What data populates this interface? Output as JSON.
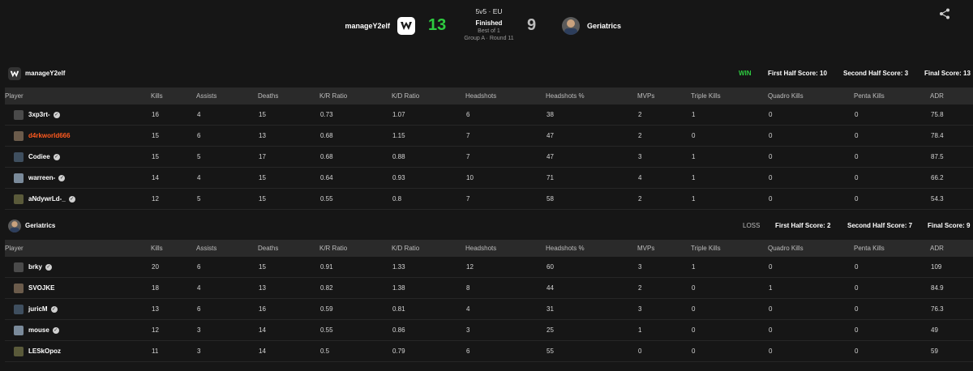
{
  "header": {
    "team_a": {
      "name": "manageY2elf",
      "score": "13"
    },
    "team_b": {
      "name": "Geriatrics",
      "score": "9"
    },
    "match": {
      "format": "5v5 · EU",
      "status": "Finished",
      "best_of": "Best of 1",
      "group": "Group A · Round 11"
    }
  },
  "columns": [
    "Player",
    "Kills",
    "Assists",
    "Deaths",
    "K/R Ratio",
    "K/D Ratio",
    "Headshots",
    "Headshots %",
    "MVPs",
    "Triple Kills",
    "Quadro Kills",
    "Penta Kills",
    "ADR"
  ],
  "team_a": {
    "name": "manageY2elf",
    "result": "WIN",
    "first_half": "First Half Score: 10",
    "second_half": "Second Half Score: 3",
    "final": "Final Score: 13",
    "players": [
      {
        "name": "3xp3rt-",
        "verified": true,
        "stats": [
          "16",
          "4",
          "15",
          "0.73",
          "1.07",
          "6",
          "38",
          "2",
          "1",
          "0",
          "0",
          "75.8"
        ]
      },
      {
        "name": "d4rkworld666",
        "verified": false,
        "stats": [
          "15",
          "6",
          "13",
          "0.68",
          "1.15",
          "7",
          "47",
          "2",
          "0",
          "0",
          "0",
          "78.4"
        ]
      },
      {
        "name": "Codiee",
        "verified": true,
        "stats": [
          "15",
          "5",
          "17",
          "0.68",
          "0.88",
          "7",
          "47",
          "3",
          "1",
          "0",
          "0",
          "87.5"
        ]
      },
      {
        "name": "warreen-",
        "verified": true,
        "stats": [
          "14",
          "4",
          "15",
          "0.64",
          "0.93",
          "10",
          "71",
          "4",
          "1",
          "0",
          "0",
          "66.2"
        ]
      },
      {
        "name": "aNdywrLd-_",
        "verified": true,
        "stats": [
          "12",
          "5",
          "15",
          "0.55",
          "0.8",
          "7",
          "58",
          "2",
          "1",
          "0",
          "0",
          "54.3"
        ]
      }
    ]
  },
  "team_b": {
    "name": "Geriatrics",
    "result": "LOSS",
    "first_half": "First Half Score: 2",
    "second_half": "Second Half Score: 7",
    "final": "Final Score: 9",
    "players": [
      {
        "name": "brky",
        "verified": true,
        "stats": [
          "20",
          "6",
          "15",
          "0.91",
          "1.33",
          "12",
          "60",
          "3",
          "1",
          "0",
          "0",
          "109"
        ]
      },
      {
        "name": "SVOJKE",
        "verified": false,
        "stats": [
          "18",
          "4",
          "13",
          "0.82",
          "1.38",
          "8",
          "44",
          "2",
          "0",
          "1",
          "0",
          "84.9"
        ]
      },
      {
        "name": "juricM",
        "verified": true,
        "stats": [
          "13",
          "6",
          "16",
          "0.59",
          "0.81",
          "4",
          "31",
          "3",
          "0",
          "0",
          "0",
          "76.3"
        ]
      },
      {
        "name": "mouse",
        "verified": true,
        "stats": [
          "12",
          "3",
          "14",
          "0.55",
          "0.86",
          "3",
          "25",
          "1",
          "0",
          "0",
          "0",
          "49"
        ]
      },
      {
        "name": "LESkOpoz",
        "verified": false,
        "stats": [
          "11",
          "3",
          "14",
          "0.5",
          "0.79",
          "6",
          "55",
          "0",
          "0",
          "0",
          "0",
          "59"
        ]
      }
    ]
  },
  "colors": {
    "win": "#2ecc40",
    "loss_score": "#bdbdbd",
    "highlight_name": "#ff5a1f"
  },
  "icons": {
    "share": "share-icon",
    "verified": "verified-check-icon"
  }
}
